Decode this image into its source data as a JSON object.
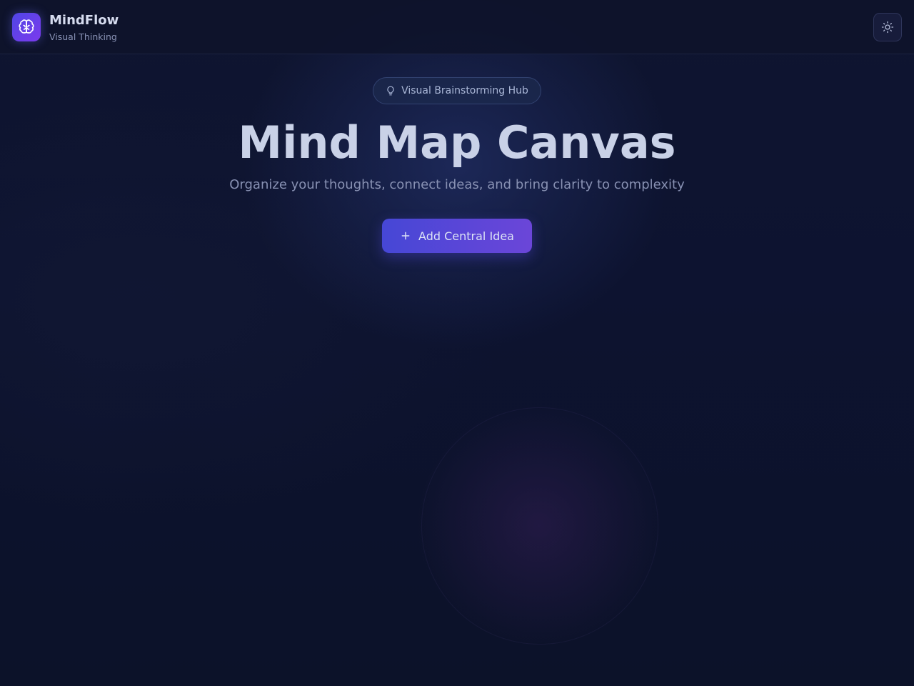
{
  "header": {
    "app_name": "MindFlow",
    "app_subtitle": "Visual Thinking",
    "logo_icon": "brain-icon",
    "theme_toggle_icon": "sun-icon"
  },
  "hero": {
    "badge_icon": "lightbulb-icon",
    "badge_label": "Visual Brainstorming Hub",
    "title": "Mind Map Canvas",
    "subtitle": "Organize your thoughts, connect ideas, and bring clarity to complexity",
    "cta_icon": "plus-icon",
    "cta_label": "Add Central Idea"
  },
  "colors": {
    "background": "#0d1330",
    "accent_start": "#4647d6",
    "accent_end": "#6b46d8",
    "title_text": "#c9d1e7",
    "muted_text": "#8891b3"
  }
}
